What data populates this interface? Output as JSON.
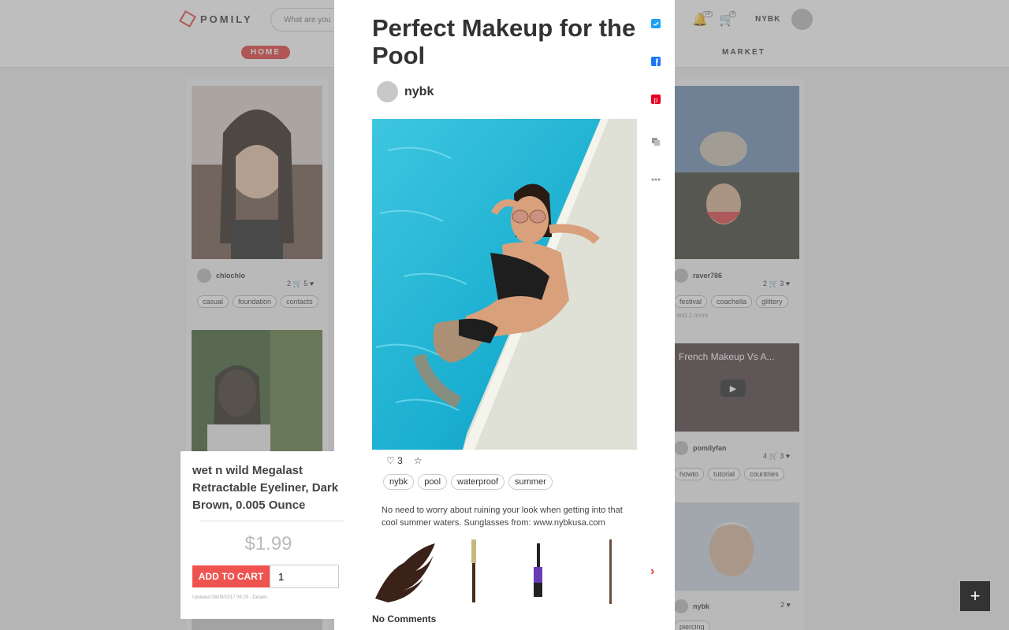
{
  "header": {
    "brand": "POMILY",
    "search_placeholder": "What are you",
    "nav_home": "HOME",
    "nav_market": "MARKET",
    "notif_count": "14",
    "cart_count": "0",
    "username": "NYBK"
  },
  "feed_left": [
    {
      "user": "chlochlo",
      "carts": "2",
      "likes": "5",
      "tags": [
        "casual",
        "foundation",
        "contacts"
      ]
    },
    {
      "user": "",
      "carts": "",
      "likes": "",
      "tags": []
    }
  ],
  "feed_right": [
    {
      "user": "raver786",
      "carts": "2",
      "likes": "3",
      "tags": [
        "festival",
        "coachella",
        "glittery"
      ],
      "extra": "and 1 more"
    },
    {
      "user": "pomilyfan",
      "carts": "4",
      "likes": "3",
      "tags": [
        "howto",
        "tutorial",
        "countries"
      ],
      "video_title": "French Makeup Vs A..."
    },
    {
      "user": "nybk",
      "carts": "",
      "likes": "2",
      "tags": [
        "piercing"
      ]
    }
  ],
  "post": {
    "title": "Perfect Makeup for the Pool",
    "author": "nybk",
    "likes": "3",
    "tags": [
      "nybk",
      "pool",
      "waterproof",
      "summer"
    ],
    "description": "No need to worry about ruining your look when getting into that cool summer waters. Sunglasses from: www.nybkusa.com",
    "comments": "No Comments"
  },
  "share_icons": [
    "twitter-icon",
    "facebook-icon",
    "pinterest-icon",
    "copy-icon",
    "more-icon"
  ],
  "product_popup": {
    "title": "wet n wild Megalast Retractable Eyeliner, Dark Brown, 0.005 Ounce",
    "price": "$1.99",
    "add_to_cart": "ADD TO CART",
    "quantity": "1",
    "meta": "Updated 08/09/2017 06:25 - Details"
  },
  "colors": {
    "accent": "#e53935",
    "overlay": "rgba(120,120,120,0.48)"
  }
}
